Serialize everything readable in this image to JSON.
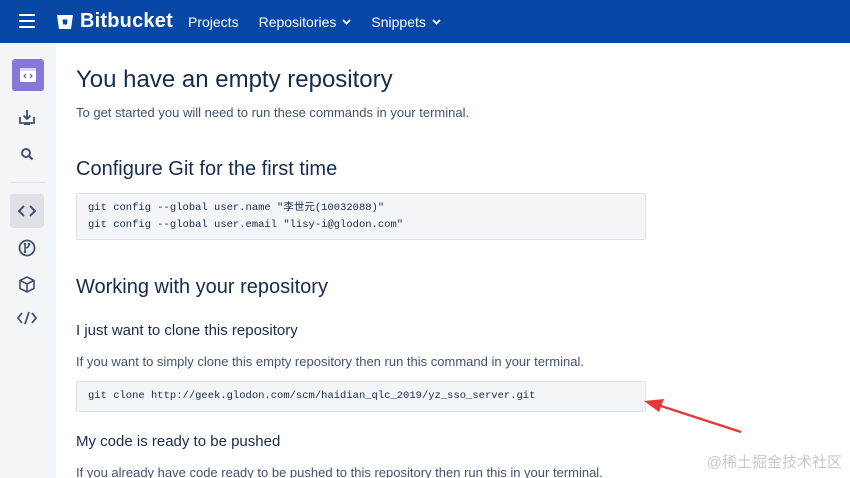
{
  "header": {
    "brand": "Bitbucket",
    "nav": [
      {
        "label": "Projects",
        "has_dropdown": false
      },
      {
        "label": "Repositories",
        "has_dropdown": true
      },
      {
        "label": "Snippets",
        "has_dropdown": true
      }
    ],
    "colors": {
      "bar": "#0747a6",
      "text": "#ffffff"
    }
  },
  "sidebar": {
    "items": [
      {
        "icon": "repository-avatar-icon"
      },
      {
        "icon": "clone-download-icon"
      },
      {
        "icon": "search-icon"
      },
      {
        "icon": "source-code-icon",
        "active": true
      },
      {
        "icon": "branches-icon"
      },
      {
        "icon": "builds-box-icon"
      },
      {
        "icon": "code-tag-icon"
      }
    ]
  },
  "main": {
    "title": "You have an empty repository",
    "intro": "To get started you will need to run these commands in your terminal.",
    "configure": {
      "heading": "Configure Git for the first time",
      "code_lines": [
        "git config --global user.name \"李世元(10032088)\"",
        "git config --global user.email \"lisy-i@glodon.com\""
      ]
    },
    "working": {
      "heading": "Working with your repository",
      "clone": {
        "heading": "I just want to clone this repository",
        "text": "If you want to simply clone this empty repository then run this command in your terminal.",
        "code_lines": [
          "git clone http://geek.glodon.com/scm/haidian_qlc_2019/yz_sso_server.git"
        ]
      },
      "push": {
        "heading": "My code is ready to be pushed",
        "text": "If you already have code ready to be pushed to this repository then run this in your terminal."
      }
    }
  },
  "annotation": {
    "arrow_color": "#e53935"
  },
  "watermark": "@稀土掘金技术社区"
}
